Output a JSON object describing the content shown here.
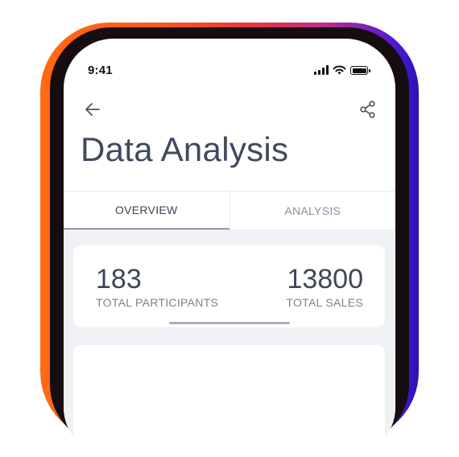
{
  "status_bar": {
    "time": "9:41",
    "icons": [
      "signal-icon",
      "wifi-icon",
      "battery-icon"
    ]
  },
  "header": {
    "back_icon": "arrow-left-icon",
    "share_icon": "share-icon",
    "title": "Data Analysis"
  },
  "tabs": [
    {
      "label": "OVERVIEW",
      "active": true
    },
    {
      "label": "ANALYSIS",
      "active": false
    }
  ],
  "stats": {
    "participants": {
      "value": "183",
      "label": "TOTAL PARTICIPANTS"
    },
    "sales": {
      "value": "13800",
      "label": "TOTAL SALES"
    }
  },
  "colors": {
    "title": "#3f4a5e",
    "content_background": "#f0f1f4",
    "active_tab": "#3a4356",
    "inactive_tab": "#8a90a0"
  }
}
